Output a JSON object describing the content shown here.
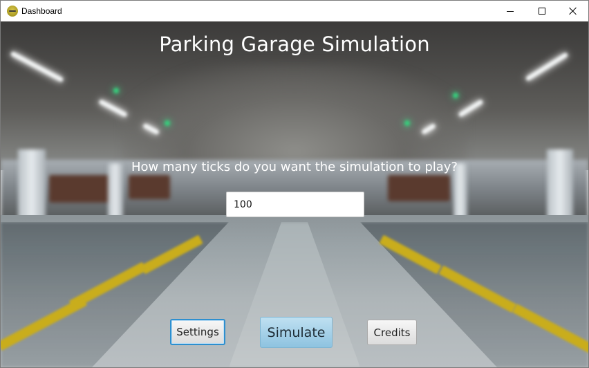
{
  "window": {
    "title": "Dashboard",
    "icon": "app-icon"
  },
  "main": {
    "heading": "Parking Garage Simulation",
    "prompt": "How many ticks do you want the simulation to play?",
    "ticks_value": "100"
  },
  "buttons": {
    "settings": "Settings",
    "simulate": "Simulate",
    "credits": "Credits"
  },
  "colors": {
    "simulate_button": "#a8d2ea",
    "focused_border": "#2e8fcf",
    "stripe_yellow": "#c9ad1c"
  }
}
